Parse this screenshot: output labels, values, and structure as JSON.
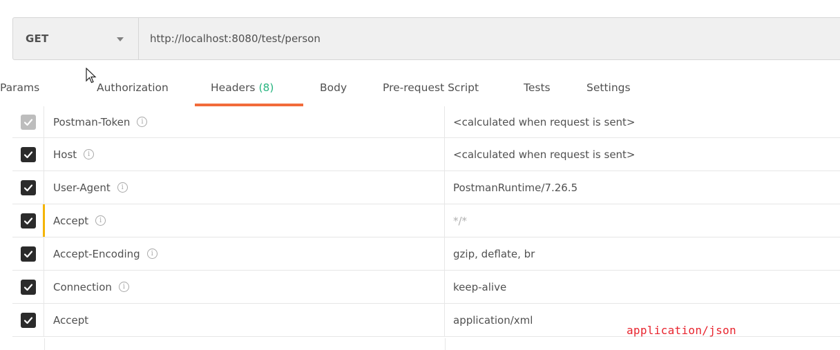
{
  "request": {
    "method": "GET",
    "url": "http://localhost:8080/test/person"
  },
  "tabs": [
    {
      "label": "Params"
    },
    {
      "label": "Authorization"
    },
    {
      "label": "Headers",
      "count": "(8)",
      "active": true
    },
    {
      "label": "Body"
    },
    {
      "label": "Pre-request Script"
    },
    {
      "label": "Tests"
    },
    {
      "label": "Settings"
    }
  ],
  "headers": [
    {
      "key": "Postman-Token",
      "value": "<calculated when request is sent>",
      "checked": true,
      "disabled": true,
      "info": true
    },
    {
      "key": "Host",
      "value": "<calculated when request is sent>",
      "checked": true,
      "info": true
    },
    {
      "key": "User-Agent",
      "value": "PostmanRuntime/7.26.5",
      "checked": true,
      "info": true
    },
    {
      "key": "Accept",
      "value": "*/*",
      "checked": true,
      "info": true,
      "muted": true,
      "editing": true
    },
    {
      "key": "Accept-Encoding",
      "value": "gzip, deflate, br",
      "checked": true,
      "info": true
    },
    {
      "key": "Connection",
      "value": "keep-alive",
      "checked": true,
      "info": true
    },
    {
      "key": "Accept",
      "value": "application/xml",
      "checked": true,
      "info": false
    }
  ],
  "annotation": "application/json",
  "colors": {
    "active_tab_underline": "#f26b3a",
    "count_green": "#26b47f",
    "annotation_red": "#e8232d",
    "edit_indicator": "#f4b400"
  }
}
